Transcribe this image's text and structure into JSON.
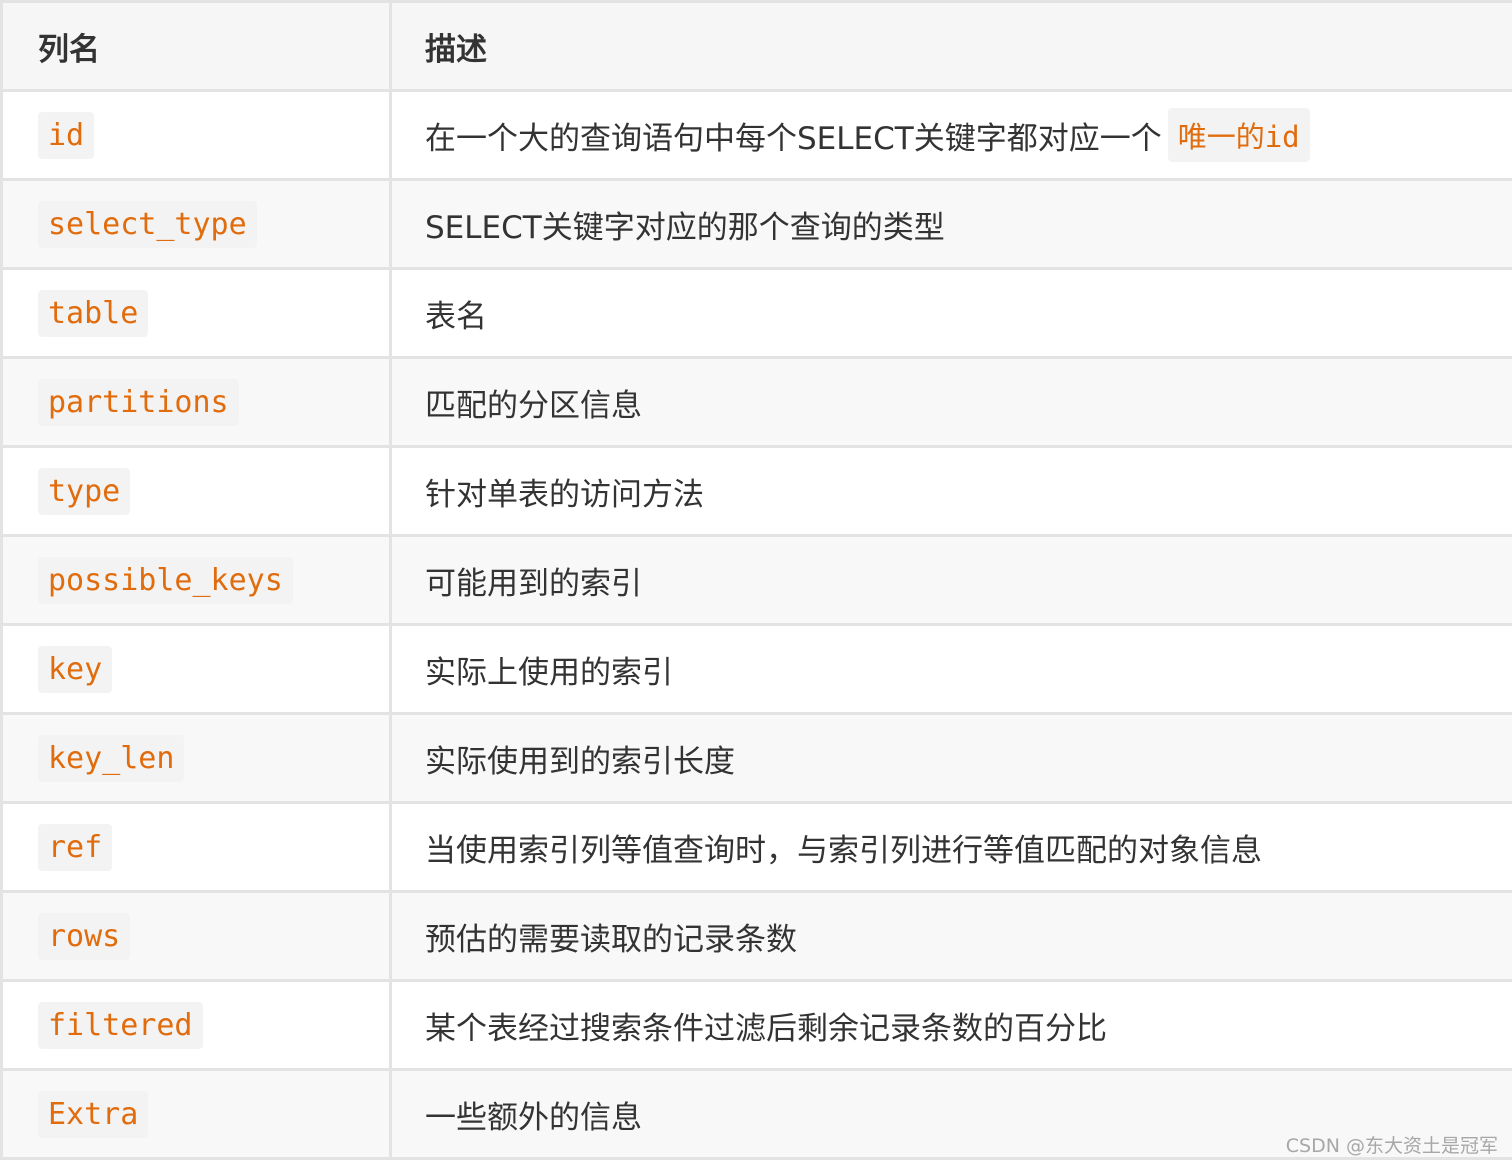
{
  "header": {
    "col1": "列名",
    "col2": "描述"
  },
  "rows": [
    {
      "name": "id",
      "desc": "在一个大的查询语句中每个SELECT关键字都对应一个",
      "desc_code": "唯一的id"
    },
    {
      "name": "select_type",
      "desc": "SELECT关键字对应的那个查询的类型"
    },
    {
      "name": "table",
      "desc": "表名"
    },
    {
      "name": "partitions",
      "desc": "匹配的分区信息"
    },
    {
      "name": "type",
      "desc": "针对单表的访问方法"
    },
    {
      "name": "possible_keys",
      "desc": "可能用到的索引"
    },
    {
      "name": "key",
      "desc": "实际上使用的索引"
    },
    {
      "name": "key_len",
      "desc": "实际使用到的索引长度"
    },
    {
      "name": "ref",
      "desc": "当使用索引列等值查询时，与索引列进行等值匹配的对象信息"
    },
    {
      "name": "rows",
      "desc": "预估的需要读取的记录条数"
    },
    {
      "name": "filtered",
      "desc": "某个表经过搜索条件过滤后剩余记录条数的百分比"
    },
    {
      "name": "Extra",
      "desc": "一些额外的信息"
    }
  ],
  "watermark": "CSDN @东大资土是冠军",
  "colors": {
    "code_text": "#e06c0d",
    "code_bg": "#f3f3f3",
    "border": "#e3e3e3",
    "text": "#333333"
  }
}
